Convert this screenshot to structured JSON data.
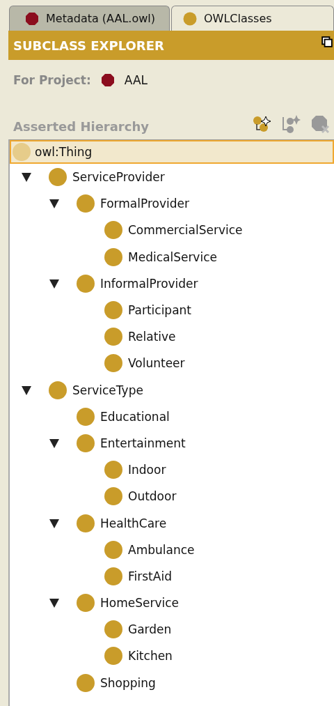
{
  "tabs": [
    {
      "label": "Metadata (AAL.owl)",
      "selected": false,
      "kind": "metadata"
    },
    {
      "label": "OWLClasses",
      "selected": true,
      "kind": "classes"
    }
  ],
  "header": {
    "title": "SUBCLASS EXPLORER"
  },
  "project": {
    "label": "For Project:",
    "name": "AAL"
  },
  "hierarchy": {
    "label": "Asserted Hierarchy"
  },
  "root": {
    "label": "owl:Thing",
    "selected": true
  },
  "tree": [
    {
      "label": "ServiceProvider",
      "selected": false,
      "expanded": true,
      "children": [
        {
          "label": "FormalProvider",
          "selected": false,
          "expanded": true,
          "children": [
            {
              "label": "CommercialService",
              "selected": false
            },
            {
              "label": "MedicalService",
              "selected": false
            }
          ]
        },
        {
          "label": "InformalProvider",
          "selected": false,
          "expanded": true,
          "children": [
            {
              "label": "Participant",
              "selected": false
            },
            {
              "label": "Relative",
              "selected": false
            },
            {
              "label": "Volunteer",
              "selected": false
            }
          ]
        }
      ]
    },
    {
      "label": "ServiceType",
      "selected": false,
      "expanded": true,
      "children": [
        {
          "label": "Educational",
          "selected": false
        },
        {
          "label": "Entertainment",
          "selected": false,
          "expanded": true,
          "children": [
            {
              "label": "Indoor",
              "selected": false
            },
            {
              "label": "Outdoor",
              "selected": false
            }
          ]
        },
        {
          "label": "HealthCare",
          "selected": false,
          "expanded": true,
          "children": [
            {
              "label": "Ambulance",
              "selected": false
            },
            {
              "label": "FirstAid",
              "selected": false
            }
          ]
        },
        {
          "label": "HomeService",
          "selected": false,
          "expanded": true,
          "children": [
            {
              "label": "Garden",
              "selected": false
            },
            {
              "label": "Kitchen",
              "selected": false
            }
          ]
        },
        {
          "label": "Shopping",
          "selected": false
        }
      ]
    }
  ]
}
